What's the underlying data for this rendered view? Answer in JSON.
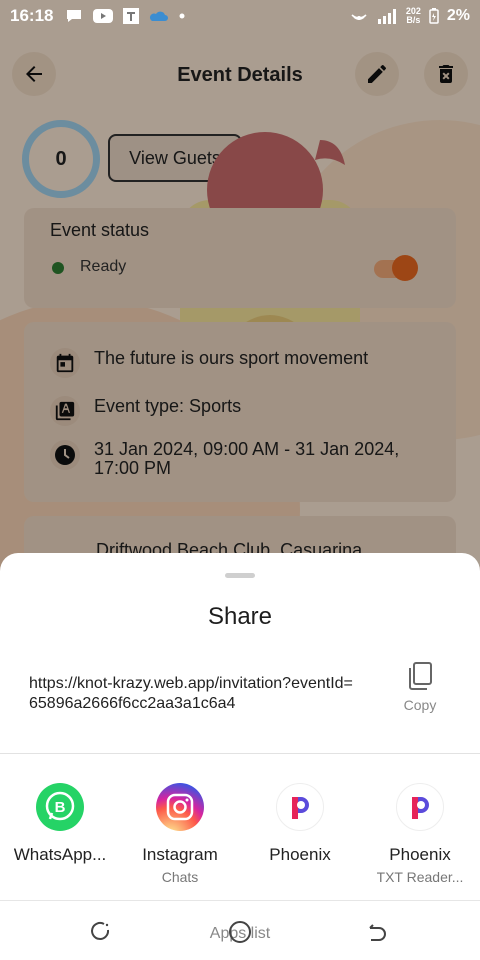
{
  "status_bar": {
    "time": "16:18",
    "speed_value": "202",
    "speed_unit": "B/s",
    "battery": "2%",
    "notification_icons": [
      "chat-bubble-icon",
      "youtube-icon",
      "t-app-icon",
      "cloud-icon",
      "dot-icon"
    ]
  },
  "app": {
    "title": "Event Details",
    "guest_count": "0",
    "view_guests_label": "View Guets",
    "status_title": "Event status",
    "status_value": "Ready",
    "status_color": "#2e7d32",
    "event_name": "The future is ours sport movement",
    "event_type": "Event type: Sports",
    "event_dates": "31 Jan 2024, 09:00 AM - 31 Jan 2024, 17:00 PM",
    "location": "Driftwood Beach Club, Casuarina"
  },
  "share": {
    "title": "Share",
    "url": "https://knot-krazy.web.app/invitation?eventId=65896a2666f6cc2aa3a1c6a4",
    "copy_label": "Copy",
    "apps": [
      {
        "name": "WhatsApp...",
        "sub": "",
        "icon": "whatsapp-business-icon",
        "color": "#25d366"
      },
      {
        "name": "Instagram",
        "sub": "Chats",
        "icon": "instagram-icon",
        "color": "#e1306c"
      },
      {
        "name": "Phoenix",
        "sub": "",
        "icon": "phoenix-browser-icon",
        "color": "#5b4bdb"
      },
      {
        "name": "Phoenix",
        "sub": "TXT Reader...",
        "icon": "phoenix-browser-icon",
        "color": "#5b4bdb"
      }
    ]
  },
  "nav": {
    "label": "Apps list"
  }
}
